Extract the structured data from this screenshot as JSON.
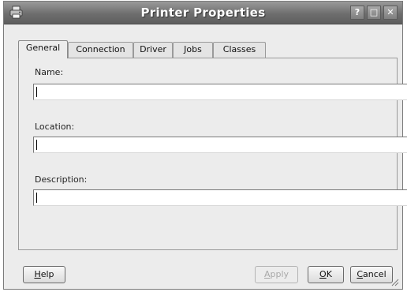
{
  "window": {
    "title": "Printer Properties",
    "titlebar_buttons": {
      "help": "?",
      "maximize": "□",
      "close": "✕"
    },
    "app_icon": "printer-icon"
  },
  "tabs": [
    {
      "label": "General",
      "active": true
    },
    {
      "label": "Connection",
      "active": false
    },
    {
      "label": "Driver",
      "active": false
    },
    {
      "label": "Jobs",
      "active": false
    },
    {
      "label": "Classes",
      "active": false
    }
  ],
  "general": {
    "name": {
      "label": "Name:",
      "value": ""
    },
    "location": {
      "label": "Location:",
      "value": ""
    },
    "description": {
      "label": "Description:",
      "value": ""
    }
  },
  "buttons": {
    "help": {
      "label": "Help",
      "mnemonic": "H",
      "rest": "elp"
    },
    "apply": {
      "label": "Apply",
      "mnemonic": "A",
      "rest": "pply",
      "enabled": false
    },
    "ok": {
      "label": "OK",
      "mnemonic": "O",
      "rest": "K"
    },
    "cancel": {
      "label": "Cancel",
      "mnemonic": "C",
      "rest": "ancel"
    }
  },
  "colors": {
    "titlebar": "#6e6e6e",
    "window_bg": "#ececec",
    "input_bg": "#ffffff"
  }
}
